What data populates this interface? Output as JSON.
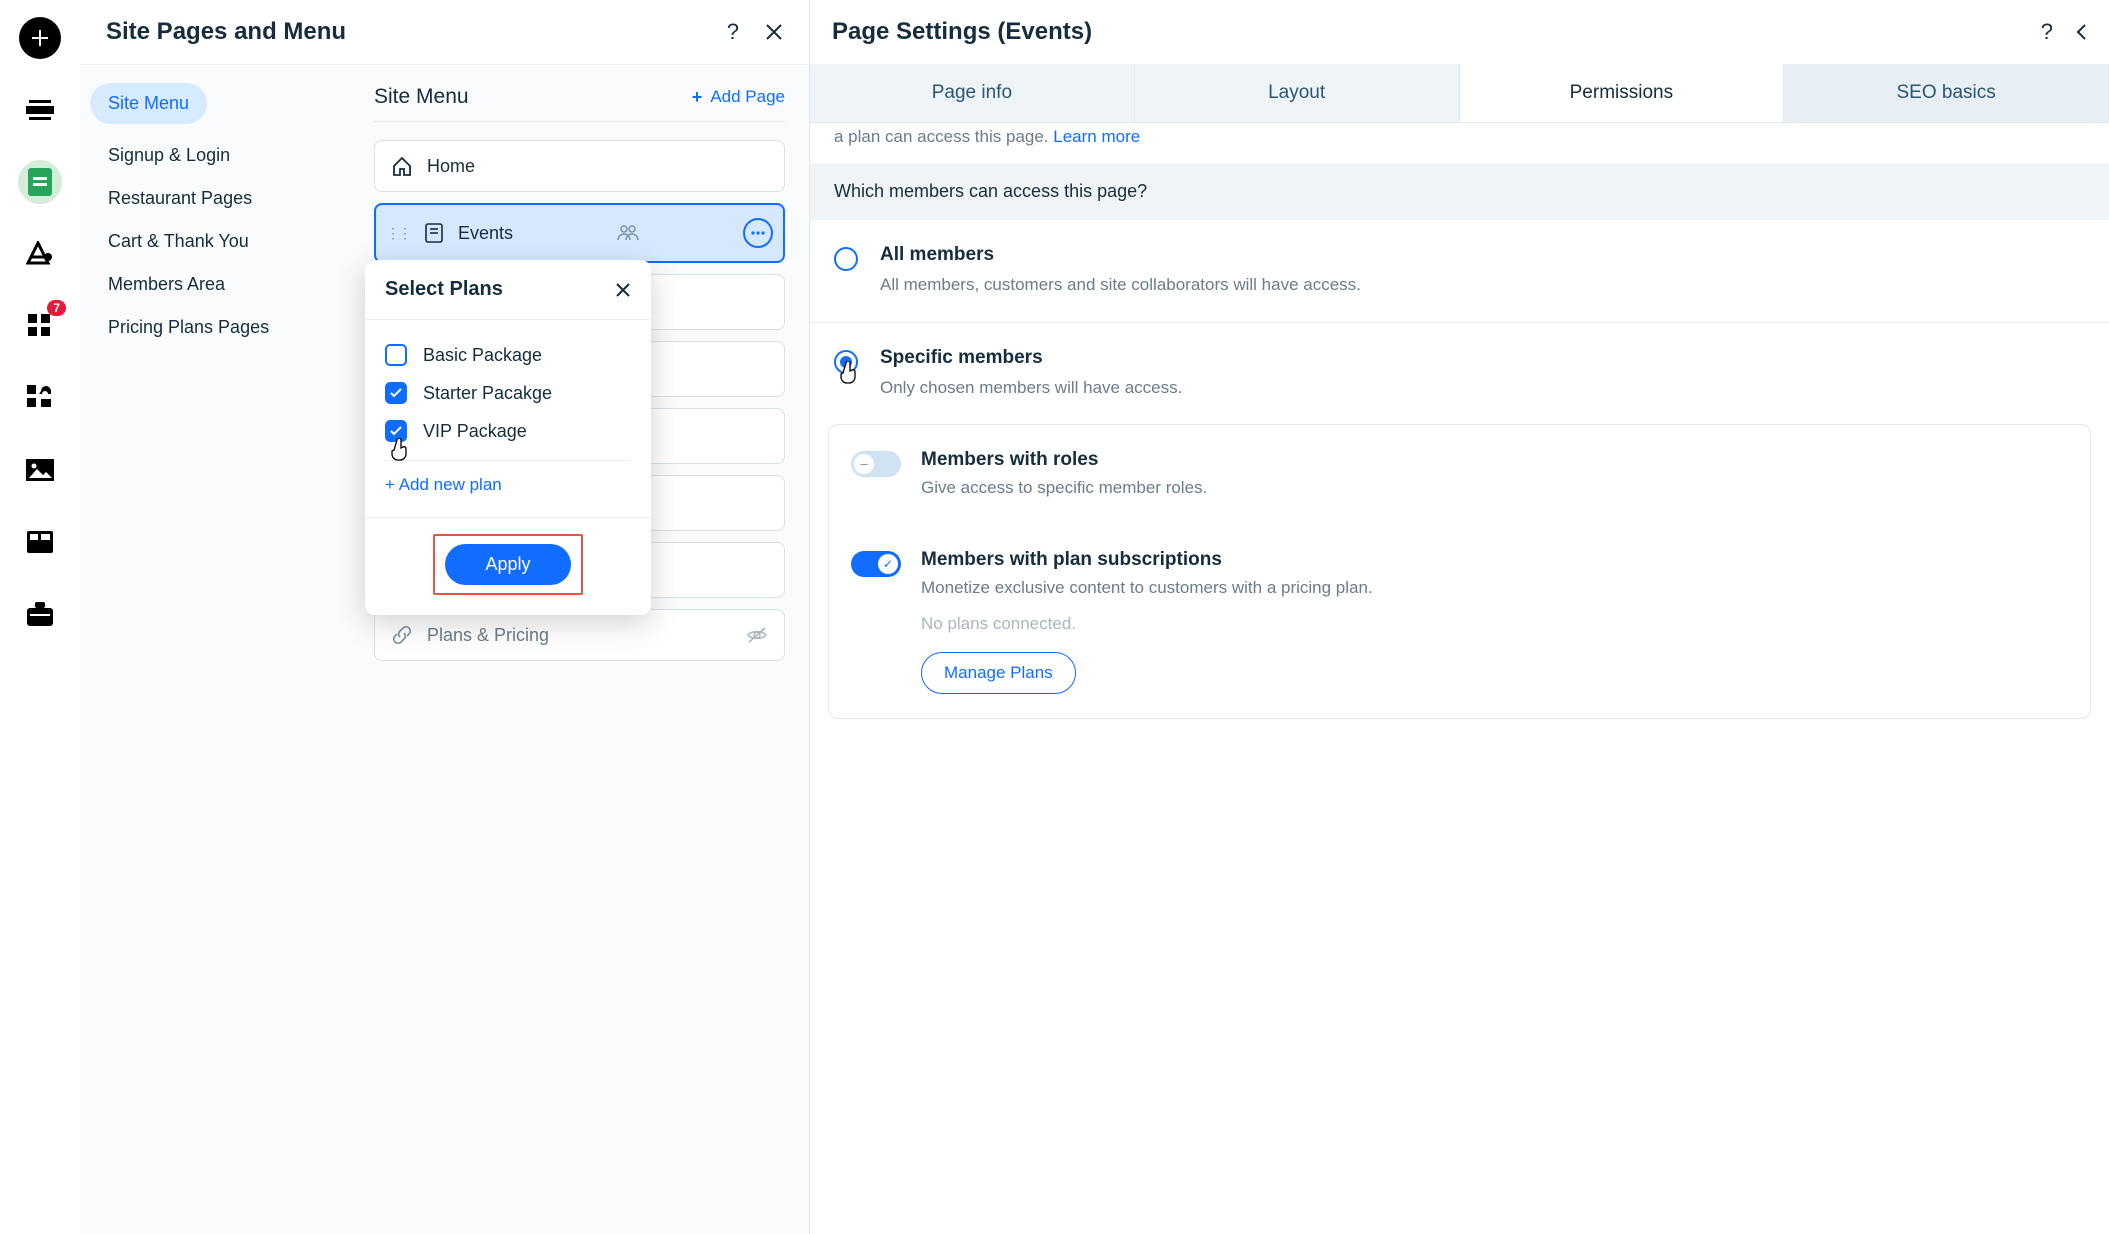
{
  "leftPanel": {
    "title": "Site Pages and Menu",
    "nav": {
      "items": [
        "Site Menu",
        "Signup & Login",
        "Restaurant Pages",
        "Cart & Thank You",
        "Members Area",
        "Pricing Plans Pages"
      ]
    },
    "siteMenu": {
      "heading": "Site Menu",
      "addPage": "Add Page",
      "pages": {
        "home": "Home",
        "events": "Events",
        "plansPricing": "Plans & Pricing"
      }
    }
  },
  "rail": {
    "badge": "7"
  },
  "popover": {
    "title": "Select Plans",
    "options": [
      {
        "label": "Basic Package",
        "checked": false
      },
      {
        "label": "Starter Pacakge",
        "checked": true
      },
      {
        "label": "VIP Package",
        "checked": true
      }
    ],
    "addNew": "+ Add new plan",
    "apply": "Apply"
  },
  "rightPanel": {
    "title": "Page Settings (Events)",
    "tabs": [
      "Page info",
      "Layout",
      "Permissions",
      "SEO basics"
    ],
    "learnPre": "a plan can access this page. ",
    "learnLink": "Learn more",
    "question": "Which members can access this page?",
    "allMembers": {
      "title": "All members",
      "desc": "All members, customers and site collaborators will have access."
    },
    "specific": {
      "title": "Specific members",
      "desc": "Only chosen members will have access."
    },
    "roles": {
      "title": "Members with roles",
      "desc": "Give access to specific member roles."
    },
    "subs": {
      "title": "Members with plan subscriptions",
      "desc": "Monetize exclusive content to customers with a pricing plan.",
      "noPlans": "No plans connected.",
      "manage": "Manage Plans"
    }
  }
}
